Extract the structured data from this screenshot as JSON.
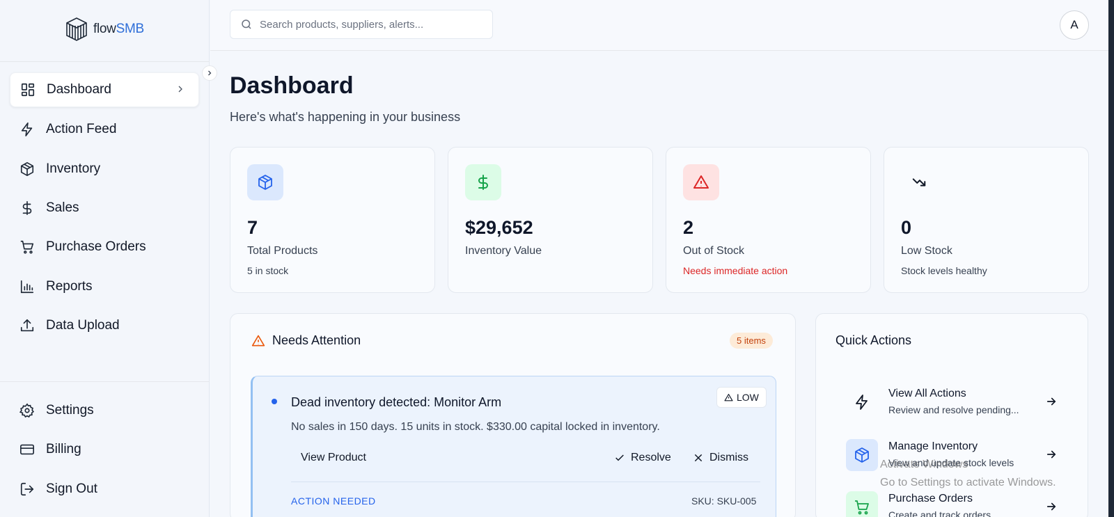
{
  "brand": {
    "name_prefix": "flow",
    "name_suffix": "SMB"
  },
  "search": {
    "placeholder": "Search products, suppliers, alerts..."
  },
  "user": {
    "avatar_initial": "A"
  },
  "sidebar": {
    "main_items": [
      {
        "label": "Dashboard",
        "icon": "layout-grid-icon",
        "active": true
      },
      {
        "label": "Action Feed",
        "icon": "lightning-icon"
      },
      {
        "label": "Inventory",
        "icon": "box-icon"
      },
      {
        "label": "Sales",
        "icon": "dollar-icon"
      },
      {
        "label": "Purchase Orders",
        "icon": "cart-icon"
      },
      {
        "label": "Reports",
        "icon": "bar-chart-icon"
      },
      {
        "label": "Data Upload",
        "icon": "upload-icon"
      }
    ],
    "bottom_items": [
      {
        "label": "Settings",
        "icon": "gear-icon"
      },
      {
        "label": "Billing",
        "icon": "credit-card-icon"
      },
      {
        "label": "Sign Out",
        "icon": "sign-out-icon"
      }
    ]
  },
  "page": {
    "title": "Dashboard",
    "subtitle": "Here's what's happening in your business"
  },
  "stats": [
    {
      "value": "7",
      "label": "Total Products",
      "note": "5 in stock",
      "icon": "box-icon",
      "accent": "#2563eb",
      "bg": "#dbe8fd"
    },
    {
      "value": "$29,652",
      "label": "Inventory Value",
      "note": "",
      "icon": "dollar-icon",
      "accent": "#16a34a",
      "bg": "#dcfce7"
    },
    {
      "value": "2",
      "label": "Out of Stock",
      "note": "Needs immediate action",
      "icon": "alert-triangle-icon",
      "accent": "#dc2626",
      "bg": "#fee2e2"
    },
    {
      "value": "0",
      "label": "Low Stock",
      "note": "Stock levels healthy",
      "icon": "trending-down-icon",
      "accent": "#111827",
      "bg": "transparent"
    }
  ],
  "attention": {
    "title": "Needs Attention",
    "count_badge": "5 items",
    "items": [
      {
        "title": "Dead inventory detected: Monitor Arm",
        "severity": "LOW",
        "description": "No sales in 150 days. 15 units in stock. $330.00 capital locked in inventory.",
        "view_label": "View Product",
        "resolve_label": "Resolve",
        "dismiss_label": "Dismiss",
        "status": "ACTION NEEDED",
        "sku": "SKU: SKU-005"
      }
    ]
  },
  "quick_actions": {
    "title": "Quick Actions",
    "items": [
      {
        "label": "View All Actions",
        "description": "Review and resolve pending...",
        "icon": "lightning-icon",
        "accent": "#111827",
        "bg": "transparent"
      },
      {
        "label": "Manage Inventory",
        "description": "View and update stock levels",
        "icon": "box-icon",
        "accent": "#2563eb",
        "bg": "#dbe8fd"
      },
      {
        "label": "Purchase Orders",
        "description": "Create and track orders",
        "icon": "cart-icon",
        "accent": "#16a34a",
        "bg": "#dcfce7"
      }
    ]
  },
  "os_watermark": {
    "line1": "Activate Windows",
    "line2": "Go to Settings to activate Windows."
  }
}
